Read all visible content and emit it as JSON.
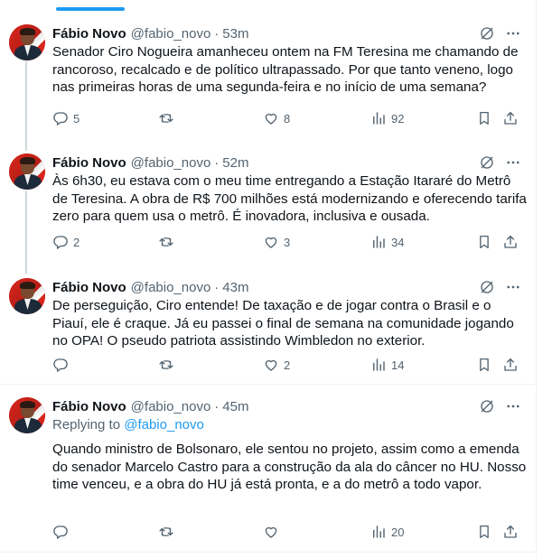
{
  "tweets": [
    {
      "name": "Fábio Novo",
      "handle": "@fabio_novo",
      "dot": "·",
      "time": "53m",
      "text": "Senador Ciro Nogueira amanheceu ontem na FM Teresina me chamando de rancoroso, recalcado e de político ultrapassado. Por que tanto veneno, logo nas primeiras horas de uma segunda-feira e no início de uma semana?",
      "replies": "5",
      "retweets": "",
      "likes": "8",
      "views": "92"
    },
    {
      "name": "Fábio Novo",
      "handle": "@fabio_novo",
      "dot": "·",
      "time": "52m",
      "text": "Às 6h30, eu estava com o meu time entregando a Estação Itararé do Metrô de Teresina. A obra de R$ 700 milhões está modernizando e oferecendo tarifa zero para quem usa o metrô. É inovadora, inclusiva e ousada.",
      "replies": "2",
      "retweets": "",
      "likes": "3",
      "views": "34"
    },
    {
      "name": "Fábio Novo",
      "handle": "@fabio_novo",
      "dot": "·",
      "time": "43m",
      "text": "De perseguição, Ciro entende! De taxação e de jogar contra o Brasil e o Piauí, ele é craque. Já eu passei o final de semana na comunidade jogando no OPA! O pseudo patriota assistindo Wimbledon no exterior.",
      "replies": "",
      "retweets": "",
      "likes": "2",
      "views": "14"
    },
    {
      "name": "Fábio Novo",
      "handle": "@fabio_novo",
      "dot": "·",
      "time": "45m",
      "replying_label": "Replying to",
      "replying_handle": "@fabio_novo",
      "text": "Quando ministro de Bolsonaro, ele sentou no projeto, assim como a emenda do senador Marcelo Castro para a construção da ala do câncer no HU. Nosso time venceu, e a obra do HU já está pronta, e a do metrô a todo vapor.",
      "replies": "",
      "retweets": "",
      "likes": "",
      "views": "20"
    }
  ],
  "icons": {
    "reply": "reply-icon",
    "retweet": "retweet-icon",
    "like": "heart-icon",
    "views": "views-icon",
    "bookmark": "bookmark-icon",
    "share": "share-icon",
    "grok": "grok-icon",
    "more": "more-icon"
  },
  "colors": {
    "accent": "#1d9bf0",
    "text": "#0f1419",
    "secondary": "#536471",
    "border": "#eff3f4"
  }
}
